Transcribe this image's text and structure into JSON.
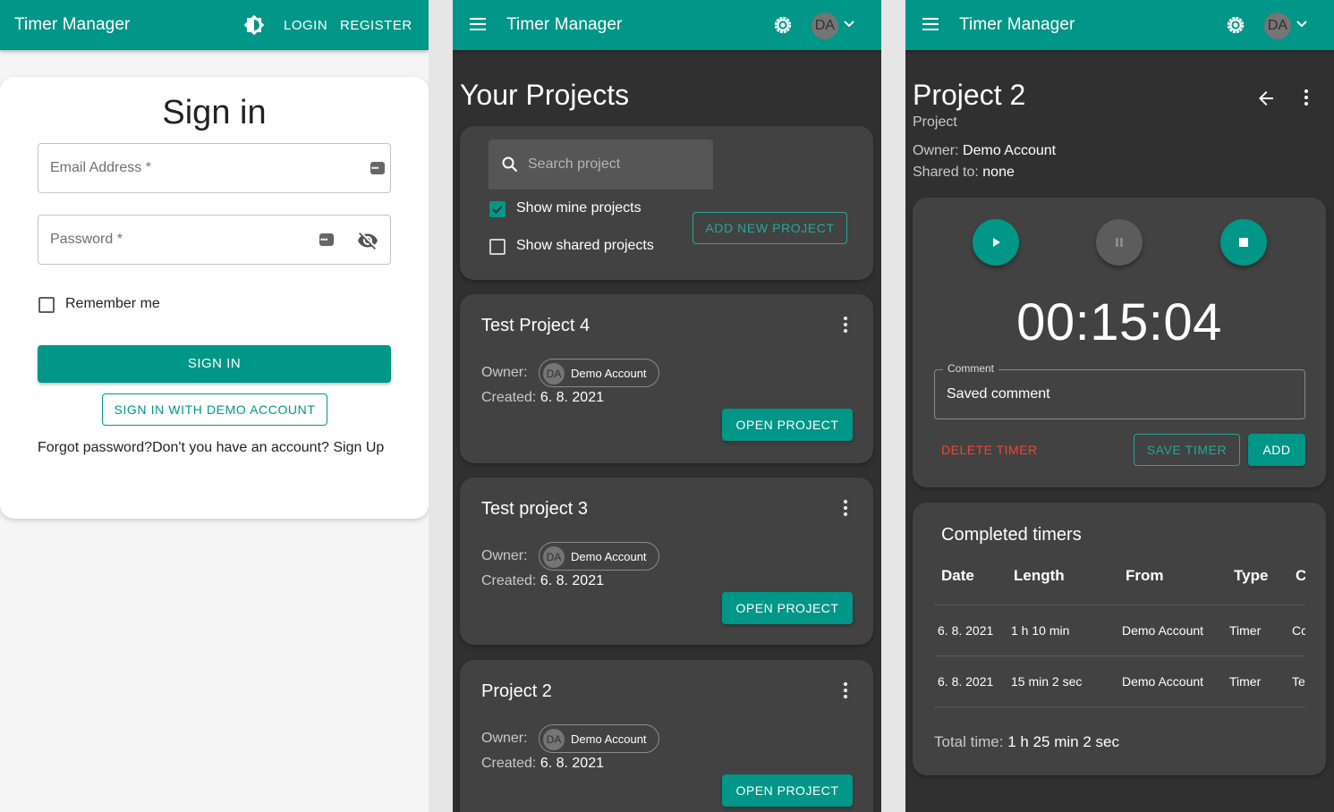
{
  "colors": {
    "primary": "#009688",
    "danger": "#f44336",
    "dark_bg": "#303030",
    "card_bg": "#424242"
  },
  "login_screen": {
    "appbar": {
      "title": "Timer Manager",
      "login": "LOGIN",
      "register": "REGISTER",
      "icon": "brightness-icon"
    },
    "title": "Sign in",
    "email_label": "Email Address *",
    "password_label": "Password *",
    "remember_me": "Remember me",
    "sign_in": "SIGN IN",
    "sign_in_demo": "SIGN IN WITH DEMO ACCOUNT",
    "forgot": "Forgot password?",
    "signup": "Don't you have an account? Sign Up"
  },
  "projects_screen": {
    "appbar": {
      "title": "Timer Manager",
      "avatar": "DA"
    },
    "heading": "Your Projects",
    "search_placeholder": "Search project",
    "show_mine": "Show mine projects",
    "show_mine_checked": true,
    "show_shared": "Show shared projects",
    "show_shared_checked": false,
    "add_new": "ADD NEW PROJECT",
    "owner_label": "Owner:",
    "created_label": "Created:",
    "open_label": "OPEN PROJECT",
    "projects": [
      {
        "name": "Test Project 4",
        "owner_initials": "DA",
        "owner": "Demo Account",
        "created": "6. 8. 2021"
      },
      {
        "name": "Test project 3",
        "owner_initials": "DA",
        "owner": "Demo Account",
        "created": "6. 8. 2021"
      },
      {
        "name": "Project 2",
        "owner_initials": "DA",
        "owner": "Demo Account",
        "created": "6. 8. 2021"
      }
    ]
  },
  "project_detail": {
    "appbar": {
      "title": "Timer Manager",
      "avatar": "DA"
    },
    "title": "Project 2",
    "subtitle": "Project",
    "owner_label": "Owner:",
    "owner": "Demo Account",
    "shared_label": "Shared to:",
    "shared": "none",
    "timer": "00:15:04",
    "comment_label": "Comment",
    "comment_value": "Saved comment",
    "delete_timer": "DELETE TIMER",
    "save_timer": "SAVE TIMER",
    "add": "ADD",
    "completed_title": "Completed timers",
    "columns": [
      "Date",
      "Length",
      "From",
      "Type",
      "C"
    ],
    "rows": [
      [
        "6. 8. 2021",
        "1 h 10 min",
        "Demo Account",
        "Timer",
        "Cc"
      ],
      [
        "6. 8. 2021",
        "15 min 2 sec",
        "Demo Account",
        "Timer",
        "Te"
      ]
    ],
    "total_label": "Total time:",
    "total_value": "1 h 25 min 2 sec"
  }
}
